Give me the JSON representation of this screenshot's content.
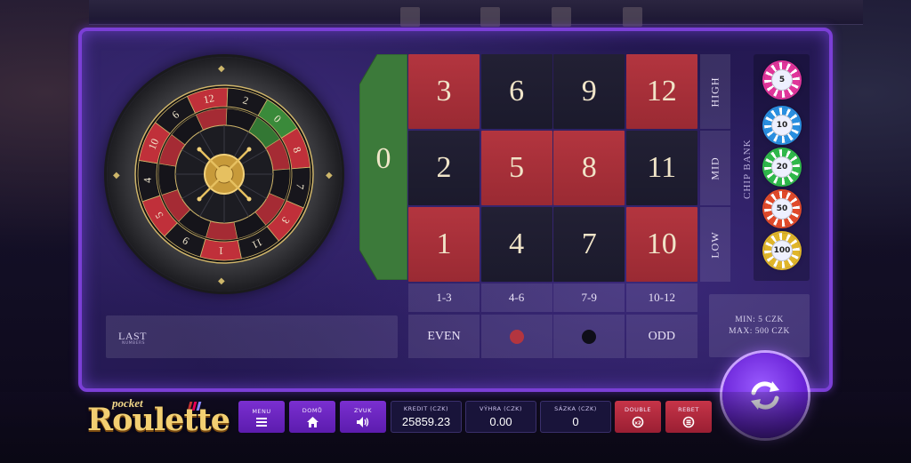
{
  "game": {
    "logo_small": "pocket",
    "logo_main": "Roulette"
  },
  "wheel": {
    "numbers": [
      "0",
      "8",
      "7",
      "3",
      "11",
      "1",
      "9",
      "5",
      "4",
      "10",
      "6",
      "12",
      "2"
    ],
    "pocket_colors": [
      "green",
      "red",
      "black",
      "red",
      "black",
      "red",
      "black",
      "red",
      "black",
      "red",
      "black",
      "red",
      "black"
    ]
  },
  "table": {
    "zero": "0",
    "rows": [
      [
        {
          "n": "3",
          "c": "red"
        },
        {
          "n": "6",
          "c": "black"
        },
        {
          "n": "9",
          "c": "black"
        },
        {
          "n": "12",
          "c": "red"
        }
      ],
      [
        {
          "n": "2",
          "c": "black"
        },
        {
          "n": "5",
          "c": "red"
        },
        {
          "n": "8",
          "c": "red"
        },
        {
          "n": "11",
          "c": "black"
        }
      ],
      [
        {
          "n": "1",
          "c": "red"
        },
        {
          "n": "4",
          "c": "black"
        },
        {
          "n": "7",
          "c": "black"
        },
        {
          "n": "10",
          "c": "red"
        }
      ]
    ],
    "side_bets": [
      "HIGH",
      "MID",
      "LOW"
    ],
    "ranges": [
      "1-3",
      "4-6",
      "7-9",
      "10-12"
    ],
    "even_label": "EVEN",
    "odd_label": "ODD",
    "red_color": "#b3353f",
    "black_color": "#1b1a2c"
  },
  "chip_bank": {
    "label": "CHIP BANK",
    "chips": [
      {
        "value": "5",
        "color": "#e0359a"
      },
      {
        "value": "10",
        "color": "#2a8fe0"
      },
      {
        "value": "20",
        "color": "#2fb84a"
      },
      {
        "value": "50",
        "color": "#e04a2a"
      },
      {
        "value": "100",
        "color": "#e0b52a"
      }
    ]
  },
  "limits": {
    "min": "MIN: 5 CZK",
    "max": "MAX: 500 CZK"
  },
  "last_numbers": {
    "title": "LAST",
    "subtitle": "NUMBERS"
  },
  "controls": {
    "menu": "MENU",
    "home": "DOMŮ",
    "sound": "ZVUK",
    "double": "DOUBLE",
    "rebet": "REBET"
  },
  "stats": {
    "credit_label": "KREDIT (CZK)",
    "credit_value": "25859.23",
    "win_label": "VÝHRA (CZK)",
    "win_value": "0.00",
    "bet_label": "SÁZKA (CZK)",
    "bet_value": "0"
  },
  "colors": {
    "accent_purple": "#7b3fd6",
    "zero_green": "#3c7a3a"
  }
}
